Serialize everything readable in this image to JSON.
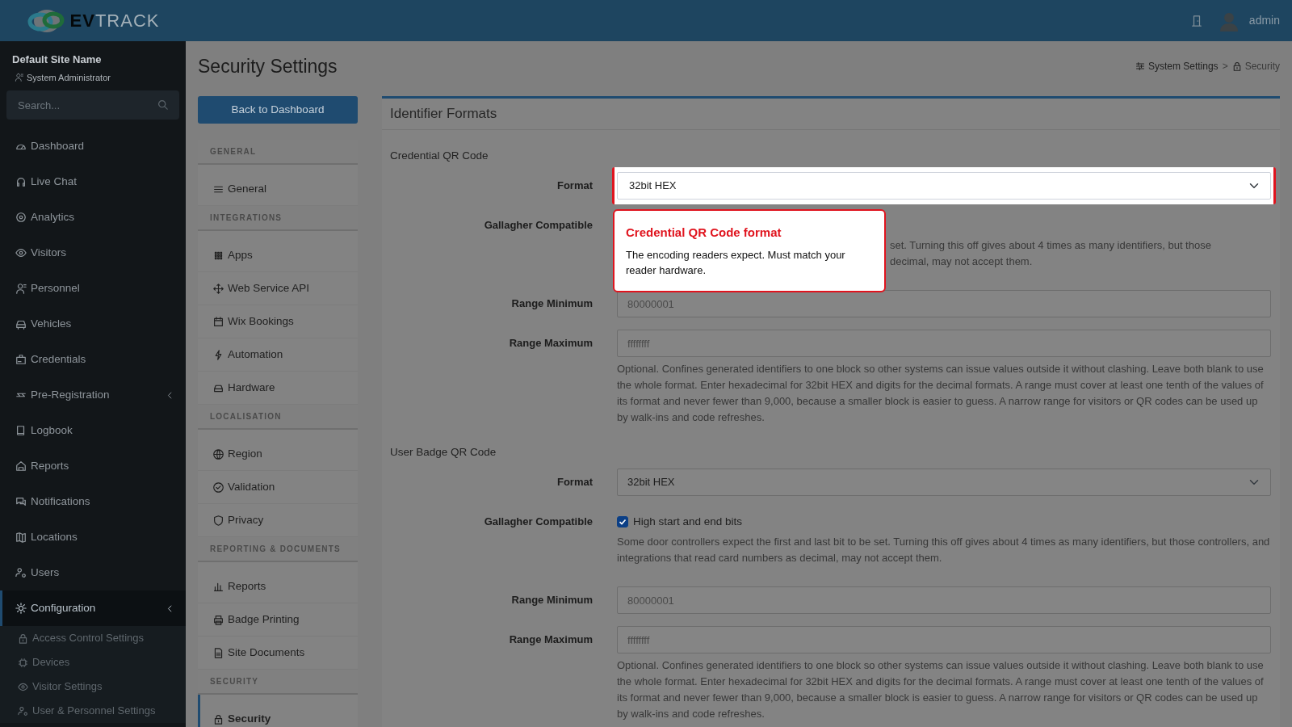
{
  "topbar": {
    "brand": "**EV**TRACK",
    "user": "admin"
  },
  "sidebar": {
    "site_name": "Default Site Name",
    "role": "System Administrator",
    "search": {
      "placeholder": "Search..."
    },
    "items": [
      {
        "label": "Dashboard",
        "selected": false
      },
      {
        "label": "Live Chat",
        "selected": false
      },
      {
        "label": "Analytics",
        "selected": false
      },
      {
        "label": "Visitors",
        "selected": false
      },
      {
        "label": "Personnel",
        "selected": false
      },
      {
        "label": "Vehicles",
        "selected": false
      },
      {
        "label": "Credentials",
        "selected": false
      },
      {
        "label": "Pre-Registration",
        "selected": false,
        "expandable": true
      },
      {
        "label": "Logbook",
        "selected": false
      },
      {
        "label": "Reports",
        "selected": false
      },
      {
        "label": "Notifications",
        "selected": false
      },
      {
        "label": "Locations",
        "selected": false
      },
      {
        "label": "Users",
        "selected": false
      },
      {
        "label": "Configuration",
        "selected": true,
        "expandable": true,
        "children": [
          {
            "label": "Access Control Settings",
            "selected": false
          },
          {
            "label": "Devices",
            "selected": false
          },
          {
            "label": "Visitor Settings",
            "selected": false
          },
          {
            "label": "User & Personnel Settings",
            "selected": false
          }
        ]
      }
    ]
  },
  "page": {
    "title": "Security Settings",
    "back_button": "Back to Dashboard",
    "breadcrumb": [
      {
        "label": "System Settings"
      },
      {
        "label": "Security"
      }
    ],
    "breadcrumb_separator": ">"
  },
  "settings_menu": [
    {
      "heading": "GENERAL",
      "items": [
        {
          "label": "General",
          "selected": false
        }
      ]
    },
    {
      "heading": "INTEGRATIONS",
      "items": [
        {
          "label": "Apps",
          "selected": false
        },
        {
          "label": "Web Service API",
          "selected": false
        },
        {
          "label": "Wix Bookings",
          "selected": false
        },
        {
          "label": "Automation",
          "selected": false
        },
        {
          "label": "Hardware",
          "selected": false
        }
      ]
    },
    {
      "heading": "LOCALISATION",
      "items": [
        {
          "label": "Region",
          "selected": false
        },
        {
          "label": "Validation",
          "selected": false
        },
        {
          "label": "Privacy",
          "selected": false
        }
      ]
    },
    {
      "heading": "REPORTING & DOCUMENTS",
      "items": [
        {
          "label": "Reports",
          "selected": false
        },
        {
          "label": "Badge Printing",
          "selected": false
        },
        {
          "label": "Site Documents",
          "selected": false
        }
      ]
    },
    {
      "heading": "SECURITY",
      "items": [
        {
          "label": "Security",
          "selected": true
        }
      ]
    }
  ],
  "card": {
    "title": "Identifier Formats",
    "sections": [
      {
        "title": "Credential QR Code",
        "fields": [
          {
            "kind": "select",
            "label": "Format",
            "value": "32bit HEX",
            "highlighted": true,
            "popover": {
              "title": "Credential QR Code format",
              "body": "The encoding readers expect. Must match your reader hardware."
            }
          },
          {
            "kind": "checkbox",
            "label": "Gallagher Compatible",
            "hint_visible_parts": [
              "set. Turning this off gives about 4 times as many identifiers, but those",
              "decimal, may not accept them."
            ]
          },
          {
            "kind": "text",
            "label": "Range Minimum",
            "placeholder": "80000001"
          },
          {
            "kind": "text",
            "label": "Range Maximum",
            "placeholder": "ffffffff"
          }
        ],
        "note": "Optional. Confines generated identifiers to one block so other systems can issue values outside it without clashing. Leave both blank to use the whole format. Enter hexadecimal for 32bit HEX and digits for the decimal formats. A range must cover at least one tenth of the values of its format and never fewer than 9,000, because a smaller block is easier to guess. A narrow range for visitors or QR codes can be used up by walk-ins and code refreshes."
      },
      {
        "title": "User Badge QR Code",
        "fields": [
          {
            "kind": "select",
            "label": "Format",
            "value": "32bit HEX",
            "highlighted": false
          },
          {
            "kind": "checkbox",
            "label": "Gallagher Compatible",
            "option": "High start and end bits",
            "checked": true,
            "hint": "Some door controllers expect the first and last bit to be set. Turning this off gives about 4 times as many identifiers, but those controllers, and integrations that read card numbers as decimal, may not accept them."
          },
          {
            "kind": "text",
            "label": "Range Minimum",
            "placeholder": "80000001"
          },
          {
            "kind": "text",
            "label": "Range Maximum",
            "placeholder": "ffffffff"
          }
        ],
        "note": "Optional. Confines generated identifiers to one block so other systems can issue values outside it without clashing. Leave both blank to use the whole format. Enter hexadecimal for 32bit HEX and digits for the decimal formats. A range must cover at least one tenth of the values of its format and never fewer than 9,000, because a smaller block is easier to guess. A narrow range for visitors or QR codes can be used up by walk-ins and code refreshes."
      }
    ]
  }
}
